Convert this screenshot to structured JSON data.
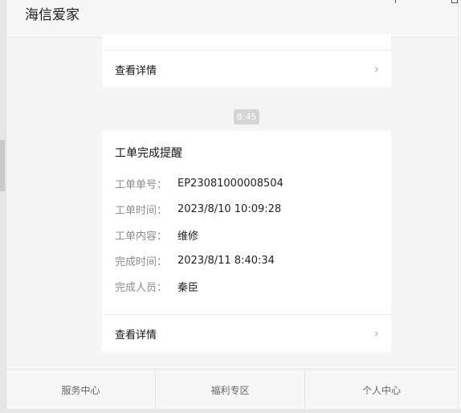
{
  "header": {
    "title": "海信爱家"
  },
  "messages": {
    "first_card": {
      "detail_label": "查看详情"
    },
    "timestamp": "8:45",
    "completion_card": {
      "title": "工单完成提醒",
      "fields": [
        {
          "label": "工单单号：",
          "value": "EP23081000008504"
        },
        {
          "label": "工单时间：",
          "value": "2023/8/10 10:09:28"
        },
        {
          "label": "工单内容：",
          "value": "维修"
        },
        {
          "label": "完成时间：",
          "value": "2023/8/11 8:40:34"
        },
        {
          "label": "完成人员：",
          "value": "秦臣"
        }
      ],
      "detail_label": "查看详情"
    }
  },
  "tabs": [
    {
      "label": "服务中心"
    },
    {
      "label": "福利专区"
    },
    {
      "label": "个人中心"
    }
  ],
  "icons": {
    "chevron": "chevron-right-icon"
  },
  "colors": {
    "background": "#f5f5f5",
    "card": "#ffffff",
    "timestamp_bg": "#d4d4d4",
    "label_gray": "#8c8c8c"
  }
}
